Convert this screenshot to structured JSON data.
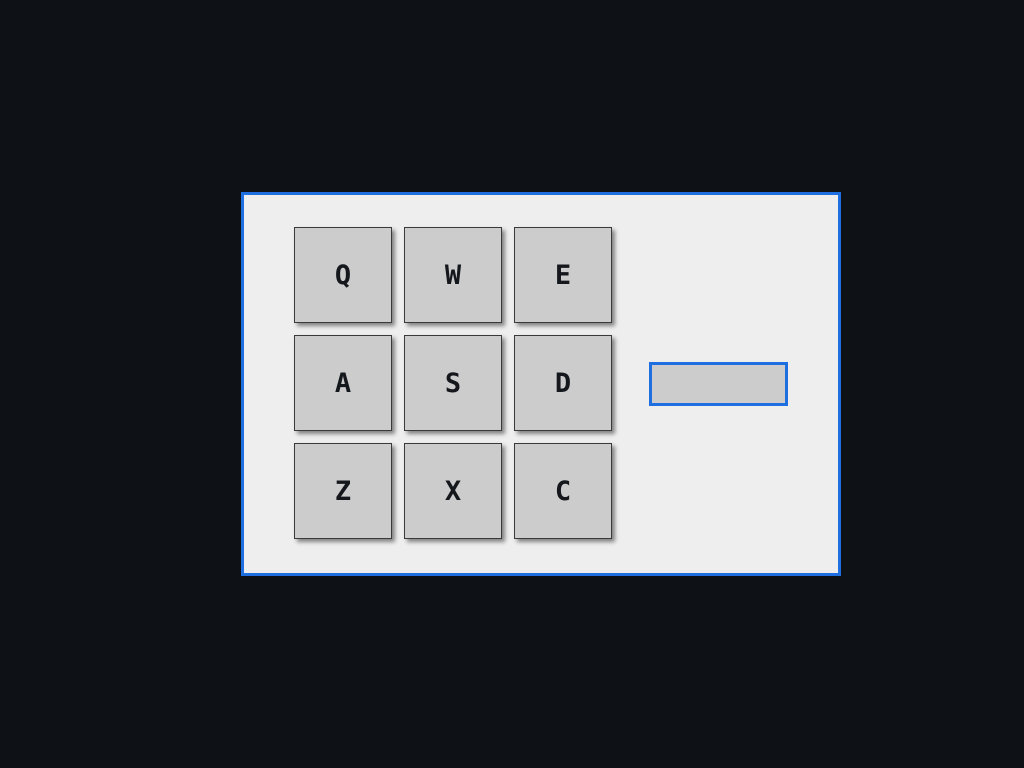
{
  "keypad": {
    "keys": [
      "Q",
      "W",
      "E",
      "A",
      "S",
      "D",
      "Z",
      "X",
      "C"
    ]
  },
  "text_field": {
    "value": ""
  },
  "colors": {
    "background": "#0e1115",
    "panel": "#eeeeee",
    "accent": "#1f6fe0",
    "key_face": "#cccccc",
    "key_text": "#14171c"
  }
}
